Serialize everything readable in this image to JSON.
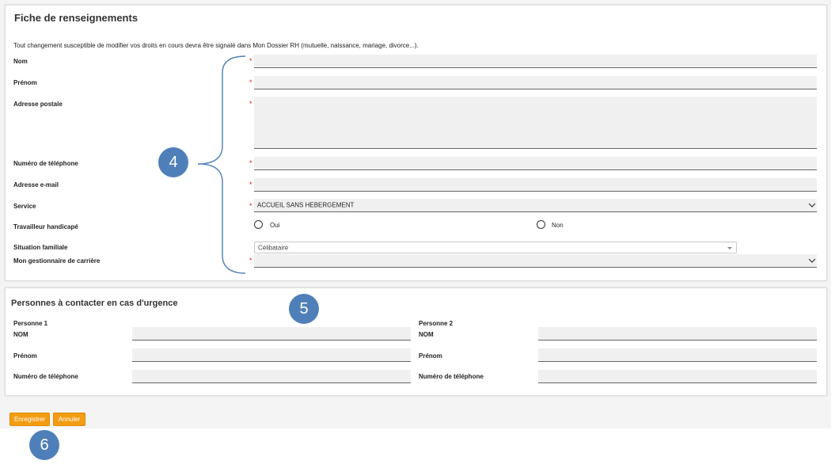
{
  "fiche": {
    "title": "Fiche de renseignements",
    "notice": "Tout changement susceptible de modifier vos droits en cours devra être signalé dans Mon Dossier RH (mutuelle, naissance, mariage, divorce...).",
    "required_mark": "*",
    "labels": {
      "nom": "Nom",
      "prenom": "Prénom",
      "adresse": "Adresse postale",
      "telephone": "Numéro de téléphone",
      "email": "Adresse e-mail",
      "service": "Service",
      "handicape": "Travailleur handicapé",
      "situation": "Situation familiale",
      "gestionnaire": "Mon gestionnaire de carrière"
    },
    "service_value": "ACCUEIL SANS HEBERGEMENT",
    "radio_oui": "Oui",
    "radio_non": "Non",
    "situation_value": "Célibataire"
  },
  "urgence": {
    "title": "Personnes à contacter en cas d'urgence",
    "person1": "Personne 1",
    "person2": "Personne 2",
    "labels": {
      "nom": "NOM",
      "prenom": "Prénom",
      "telephone": "Numéro de téléphone"
    }
  },
  "actions": {
    "save_label": "Enregistrer",
    "cancel_label": "Annuler"
  },
  "callouts": {
    "four": "4",
    "five": "5",
    "six": "6"
  },
  "colors": {
    "accent_button": "#f39c12",
    "callout": "#4f7fb8",
    "required": "#d32020"
  }
}
